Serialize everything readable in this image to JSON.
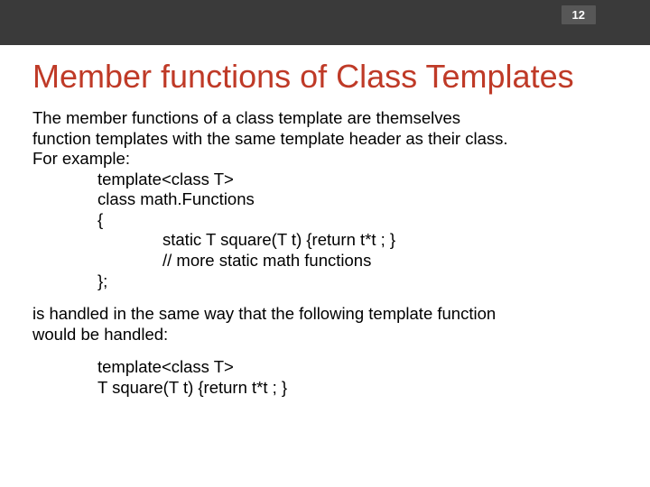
{
  "header": {
    "page_number": "12"
  },
  "title": "Member functions of Class Templates",
  "body": {
    "para1_l1": "The member functions of a class template are themselves",
    "para1_l2": "function templates with the same template header as their class.",
    "para1_l3": "For example:",
    "code1_l1": "template<class T>",
    "code1_l2": "class math.Functions",
    "code1_l3": "{",
    "code1_l4": "static T square(T t)  {return t*t ; }",
    "code1_l5": "// more static math functions",
    "code1_l6": "};",
    "para2_l1": "is handled in the same way that the following template function",
    "para2_l2": "would be handled:",
    "code2_l1": "template<class T>",
    "code2_l2": "T square(T t)  {return t*t ; }"
  }
}
